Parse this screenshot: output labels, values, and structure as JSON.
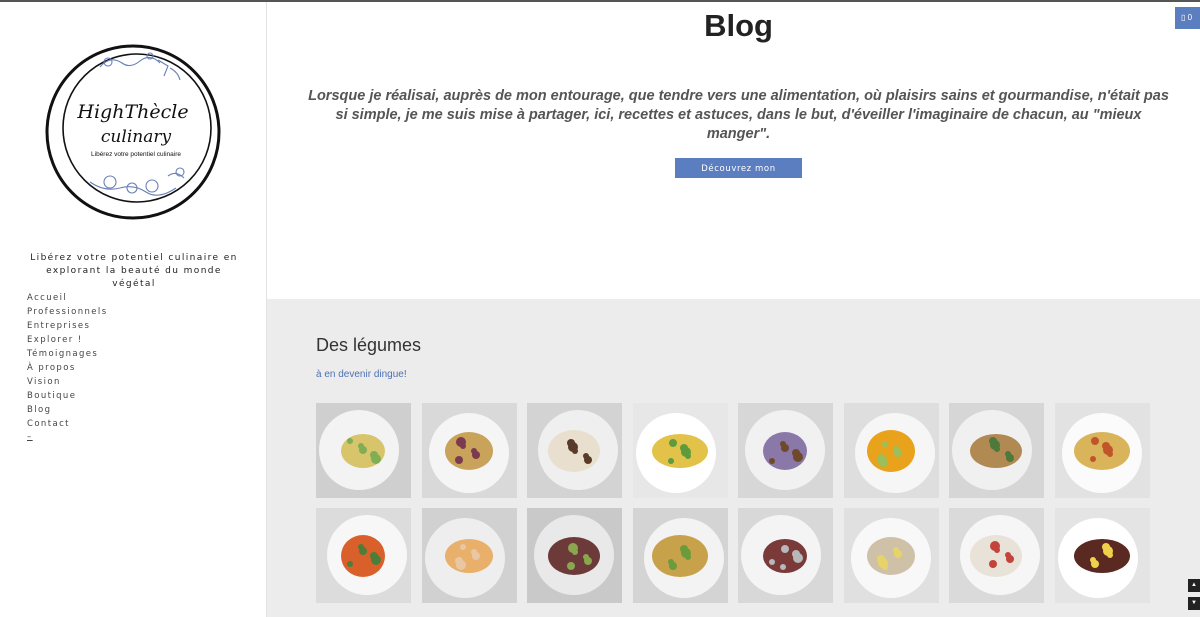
{
  "page": {
    "title": "Blog",
    "intro": "Lorsque je réalisai, auprès de mon entourage, que tendre vers une alimentation, où plaisirs sains et gourmandise, n'était pas si simple, je me suis mise à partager, ici, recettes et astuces, dans le but, d'éveiller l'imaginaire de chacun, au \"mieux manger\".",
    "cta_label": "Découvrez mon univers!"
  },
  "cart": {
    "icon": "cart-icon",
    "count": "0"
  },
  "logo": {
    "line1": "HighThècle",
    "line2": "culinary",
    "tagline": "Libérez votre potentiel culinaire"
  },
  "sidebar": {
    "tagline_line1": "Libérez votre potentiel culinaire en",
    "tagline_line2": "explorant la beauté du monde végétal",
    "nav": [
      "Accueil",
      "Professionnels",
      "Entreprises",
      "Explorer !",
      "Témoignages",
      "À propos",
      "Vision",
      "Boutique",
      "Blog",
      "Contact"
    ],
    "extra": "–"
  },
  "gallery": {
    "title": "Des légumes",
    "subtitle": "à en devenir dingue!",
    "tile_count": 16
  },
  "scroll": {
    "up": "▲",
    "down": "▼"
  },
  "colors": {
    "accent": "#5b7ec0",
    "gallery_bg": "#ececec",
    "link": "#4d72b3"
  }
}
